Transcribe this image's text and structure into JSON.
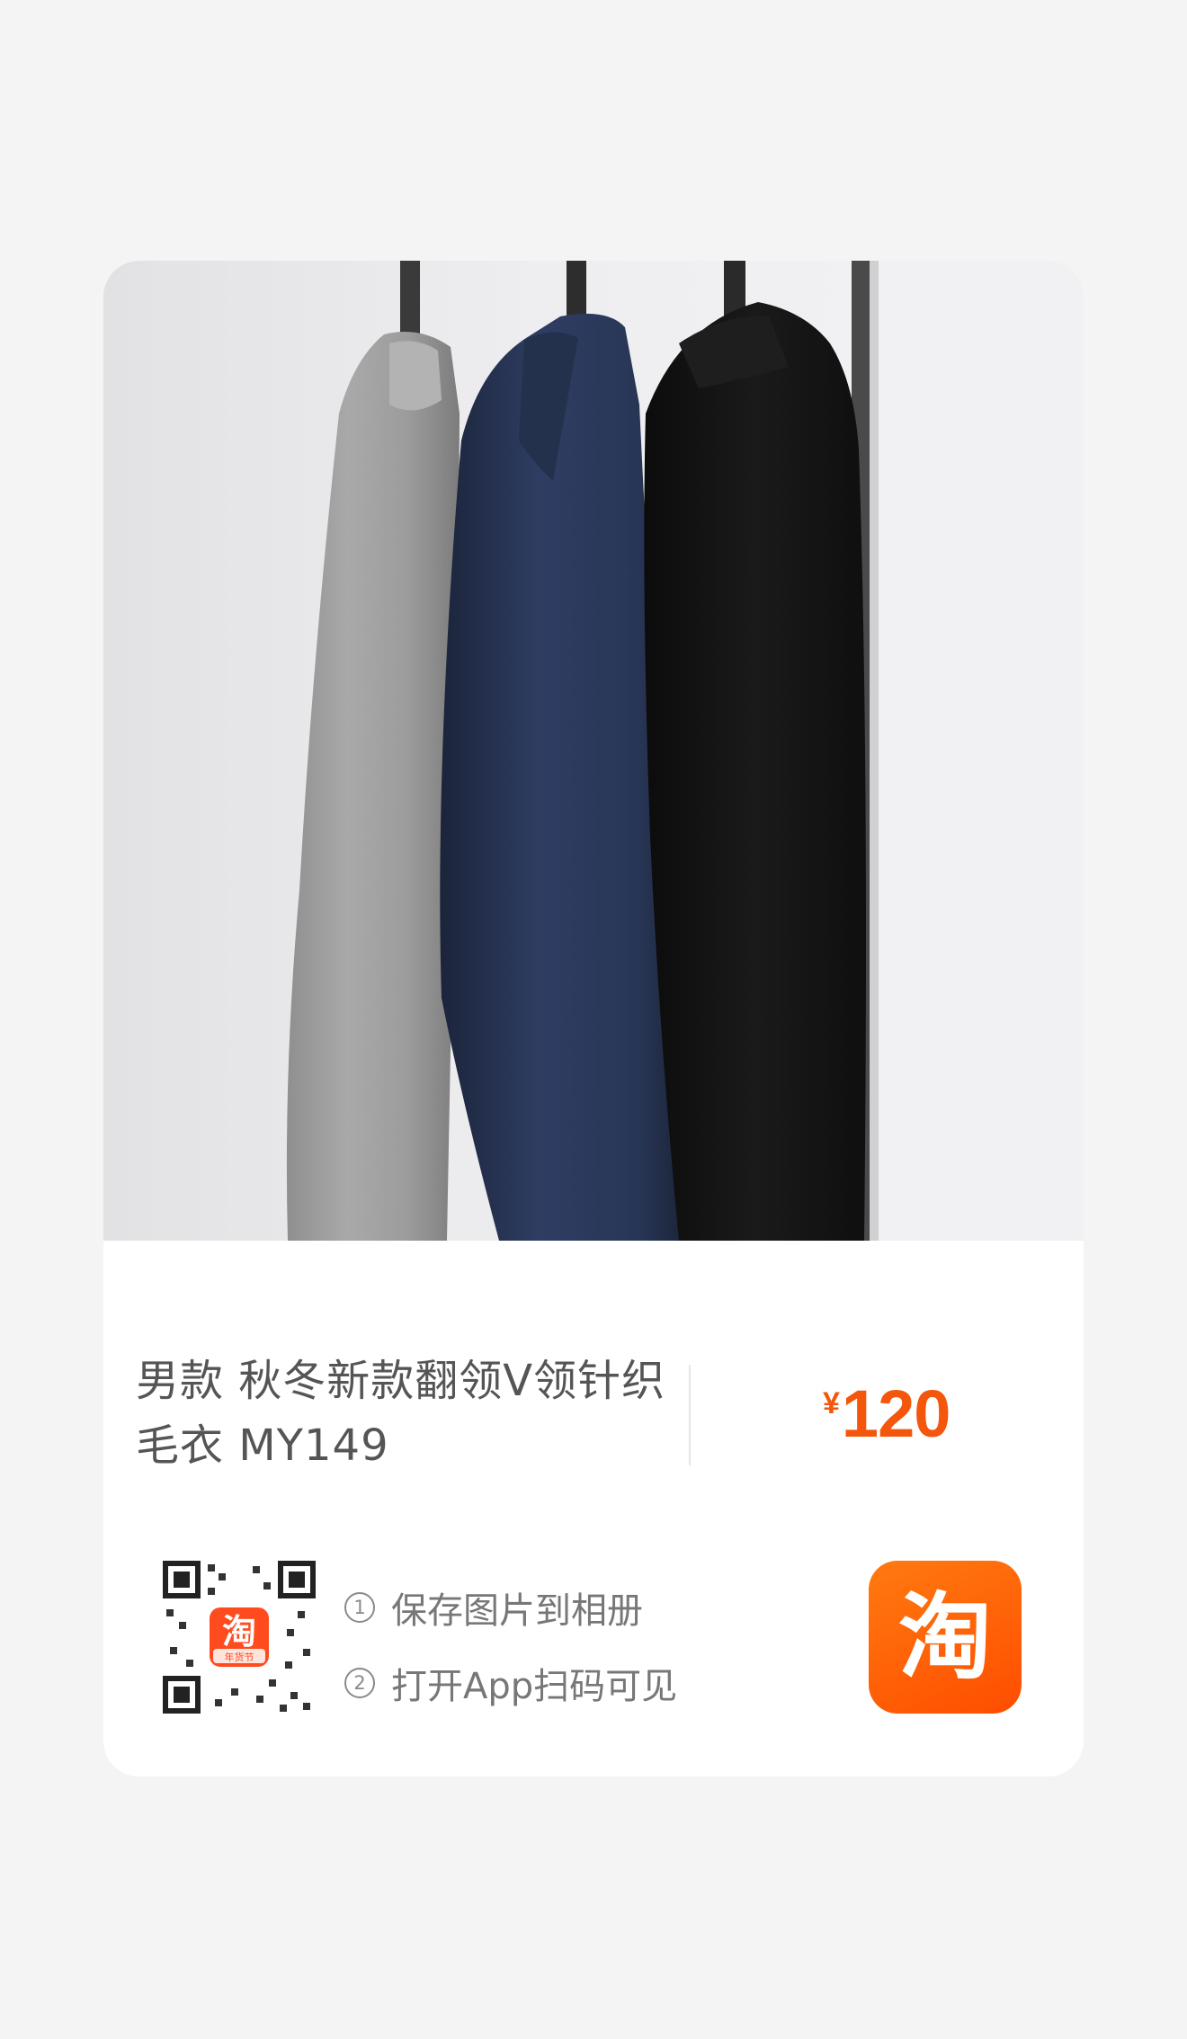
{
  "product": {
    "image_description": "Three knitted sweaters (grey, navy, black) hanging on a rack",
    "title": "男款 秋冬新款翻领V领针织毛衣 MY149",
    "currency": "¥",
    "price": "120"
  },
  "share": {
    "steps": [
      {
        "number": "1",
        "text": "保存图片到相册"
      },
      {
        "number": "2",
        "text": "打开App扫码可见"
      }
    ],
    "qr_badge_text": "淘",
    "qr_badge_subtext": "年货节",
    "app_logo_text": "淘"
  },
  "colors": {
    "price": "#f4560b",
    "brand_orange": "#ff5500",
    "background": "#f4f4f4",
    "card": "#ffffff"
  }
}
